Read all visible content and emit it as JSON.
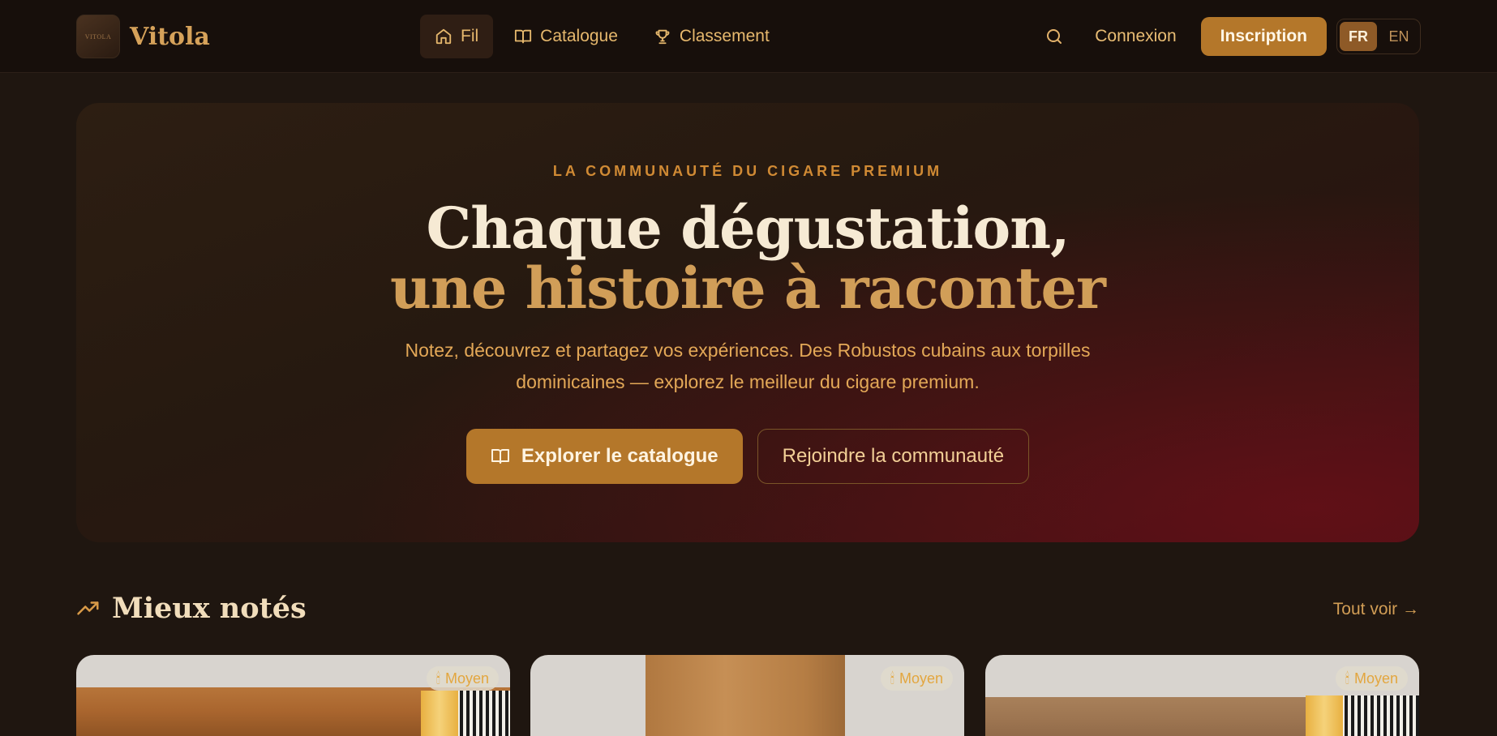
{
  "brand": {
    "name": "Vitola",
    "logo_text": "VITOLA"
  },
  "nav": {
    "links": [
      {
        "label": "Fil",
        "icon": "home-icon",
        "active": true
      },
      {
        "label": "Catalogue",
        "icon": "book-open-icon",
        "active": false
      },
      {
        "label": "Classement",
        "icon": "trophy-icon",
        "active": false
      }
    ],
    "login": "Connexion",
    "signup": "Inscription",
    "languages": [
      {
        "code": "FR",
        "active": true
      },
      {
        "code": "EN",
        "active": false
      }
    ]
  },
  "hero": {
    "eyebrow": "LA COMMUNAUTÉ DU CIGARE PREMIUM",
    "title_line1": "Chaque dégustation,",
    "title_line2": "une histoire à raconter",
    "description": "Notez, découvrez et partagez vos expériences. Des Robustos cubains aux torpilles dominicaines — explorez le meilleur du cigare premium.",
    "primary_button": "Explorer le catalogue",
    "secondary_button": "Rejoindre la communauté"
  },
  "section": {
    "title": "Mieux notés",
    "see_all": "Tout voir →",
    "cards": [
      {
        "badge": "Moyen"
      },
      {
        "badge": "Moyen"
      },
      {
        "badge": "Moyen"
      }
    ]
  },
  "colors": {
    "background": "#1f1610",
    "accent": "#b4772a",
    "gold_text": "#d19e58",
    "hero_red": "#6e1018"
  }
}
